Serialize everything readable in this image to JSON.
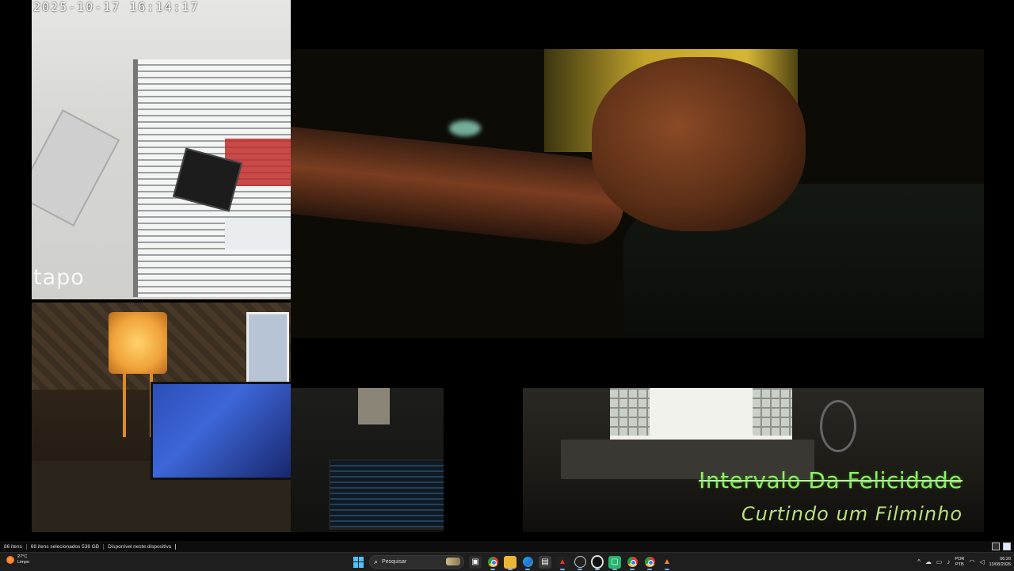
{
  "cameras": {
    "entrance": {
      "timestamp": "2025-10-17  16:14:17",
      "brand": "tapo"
    }
  },
  "overlay": {
    "title": "Intervalo Da Felicidade",
    "subtitle": "Curtindo um Filminho"
  },
  "explorer_status": {
    "items": "86 itens",
    "selected": "68 itens selecionados  536 GB",
    "availability": "Disponível neste dispositivo"
  },
  "taskbar": {
    "weather": {
      "temp": "27°C",
      "condition": "Limpo"
    },
    "search_placeholder": "Pesquisar",
    "language": {
      "line1": "POR",
      "line2": "PTB"
    },
    "clock": {
      "time": "06:20",
      "date": "13/08/2026"
    },
    "pinned_apps": [
      "chrome-icon",
      "file-explorer-icon",
      "edge-icon",
      "store-icon",
      "app-icon",
      "steam-icon",
      "obs-icon",
      "app-icon",
      "chrome-icon",
      "chrome-icon",
      "vlc-icon"
    ]
  },
  "colors": {
    "caption_title": "#8ff06a",
    "caption_subtitle": "#b9e07a",
    "taskbar_bg": "#1e1e1e",
    "accent": "#4cc2ff"
  }
}
